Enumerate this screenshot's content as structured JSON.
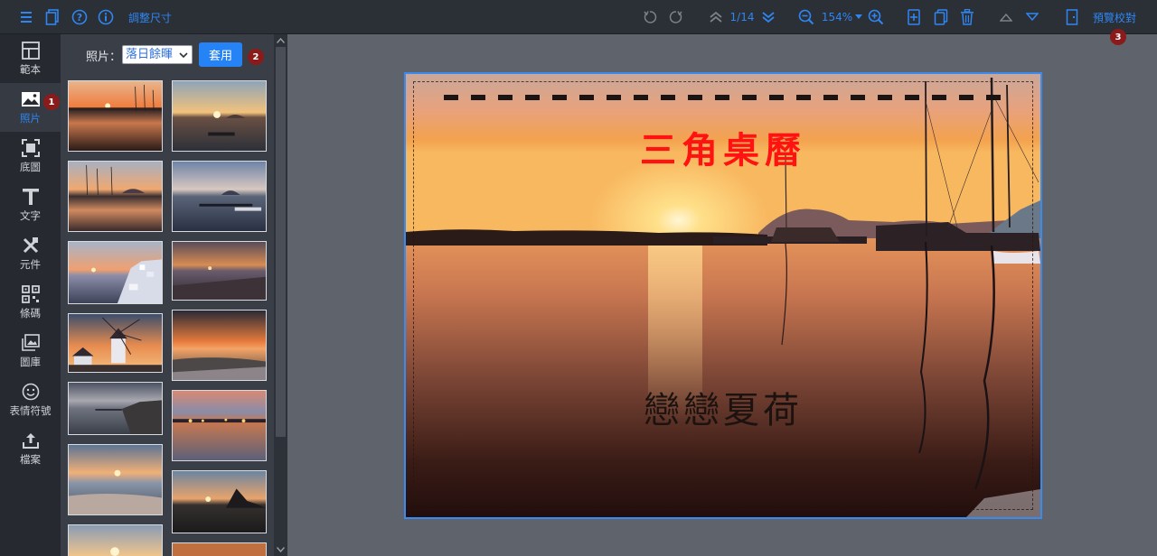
{
  "toolbar": {
    "resize_label": "調整尺寸",
    "page_indicator": "1/14",
    "zoom_level": "154%",
    "preview_label": "預覽校對"
  },
  "rail": {
    "items": [
      {
        "label": "範本",
        "icon": "template-icon"
      },
      {
        "label": "照片",
        "icon": "photo-icon",
        "active": true
      },
      {
        "label": "底圖",
        "icon": "background-icon"
      },
      {
        "label": "文字",
        "icon": "text-icon"
      },
      {
        "label": "元件",
        "icon": "element-icon"
      },
      {
        "label": "條碼",
        "icon": "barcode-icon"
      },
      {
        "label": "圖庫",
        "icon": "gallery-icon"
      },
      {
        "label": "表情符號",
        "icon": "emoji-icon"
      },
      {
        "label": "檔案",
        "icon": "upload-icon"
      }
    ]
  },
  "panel": {
    "photo_label": "照片：",
    "selected_category": "落日餘暉",
    "apply_label": "套用"
  },
  "badges": [
    "1",
    "2",
    "3"
  ],
  "canvas": {
    "title": "三角桌曆",
    "subtitle": "戀戀夏荷"
  },
  "colors": {
    "accent": "#2f86f2",
    "badge": "#8b1a1a",
    "title_red": "#ff1212",
    "page_border": "#3b8af0"
  }
}
